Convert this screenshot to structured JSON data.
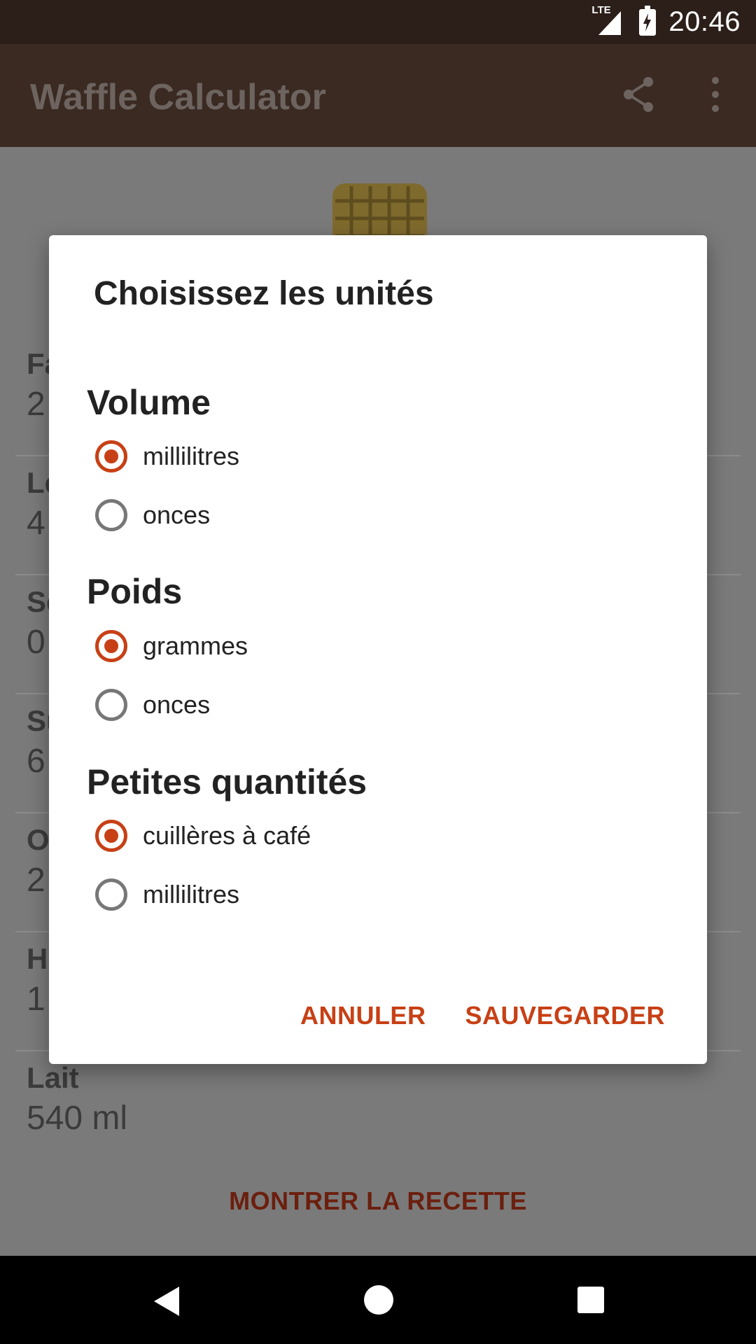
{
  "status_bar": {
    "network": "LTE",
    "time": "20:46"
  },
  "app_bar": {
    "title": "Waffle Calculator",
    "icons": [
      "share-icon",
      "more-vert-icon"
    ]
  },
  "background": {
    "items": [
      {
        "label": "Fa",
        "value": "2"
      },
      {
        "label": "Le",
        "value": "4"
      },
      {
        "label": "Se",
        "value": "0"
      },
      {
        "label": "Su",
        "value": "6"
      },
      {
        "label": "O",
        "value": "2"
      },
      {
        "label": "H",
        "value": "1"
      },
      {
        "label": "Lait",
        "value": "540 ml"
      }
    ],
    "show_recipe": "MONTRER LA RECETTE"
  },
  "dialog": {
    "title": "Choisissez les unités",
    "groups": [
      {
        "title": "Volume",
        "options": [
          {
            "label": "millilitres",
            "checked": true
          },
          {
            "label": "onces",
            "checked": false
          }
        ]
      },
      {
        "title": "Poids",
        "options": [
          {
            "label": "grammes",
            "checked": true
          },
          {
            "label": "onces",
            "checked": false
          }
        ]
      },
      {
        "title": "Petites quantités",
        "options": [
          {
            "label": "cuillères à café",
            "checked": true
          },
          {
            "label": "millilitres",
            "checked": false
          }
        ]
      }
    ],
    "cancel": "ANNULER",
    "save": "SAUVEGARDER"
  },
  "colors": {
    "accent": "#c74015",
    "app_bar": "#3a2a22",
    "status_bar": "#2c1f1a"
  }
}
